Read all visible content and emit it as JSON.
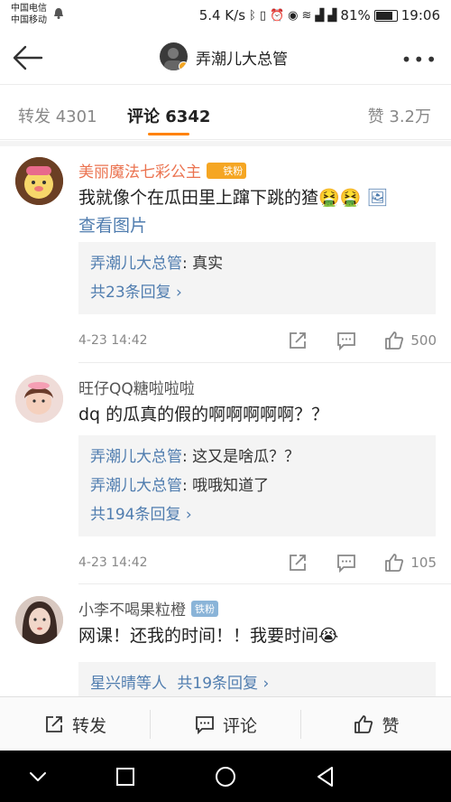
{
  "status_bar": {
    "carrier_1": "中国电信",
    "carrier_2": "中国移动",
    "speed": "5.4 K/s",
    "battery": "81%",
    "time": "19:06"
  },
  "header": {
    "title": "弄潮儿大总管"
  },
  "tabs": {
    "repost": "转发 4301",
    "comment": "评论 6342",
    "like": "赞 3.2万"
  },
  "comments": [
    {
      "name": "美丽魔法七彩公主",
      "badge": "铁粉",
      "text": "我就像个在瓜田里上蹿下跳的猹🤮🤮",
      "link": "查看图片",
      "replies": [
        {
          "who": "弄潮儿大总管",
          "text": ": 真实"
        }
      ],
      "more_replies": "共23条回复 ›",
      "time": "4-23 14:42",
      "likes": "500"
    },
    {
      "name": "旺仔QQ糖啦啦啦",
      "text": "dq 的瓜真的假的啊啊啊啊啊？？",
      "replies": [
        {
          "who": "弄潮儿大总管",
          "text": ": 这又是啥瓜？？"
        },
        {
          "who": "弄潮儿大总管",
          "text": ": 哦哦知道了"
        }
      ],
      "more_replies": "共194条回复 ›",
      "time": "4-23 14:42",
      "likes": "105"
    },
    {
      "name": "小李不喝果粒橙",
      "badge": "铁粉",
      "text": "网课！还我的时间！！我要时间😭",
      "replies_prefix": "星兴晴等人",
      "more_replies": "共19条回复 ›"
    }
  ],
  "bottom_bar": {
    "repost": "转发",
    "comment": "评论",
    "like": "赞"
  },
  "colors": {
    "accent": "#ff8200",
    "link": "#507daf",
    "name_highlight": "#eb7350"
  }
}
